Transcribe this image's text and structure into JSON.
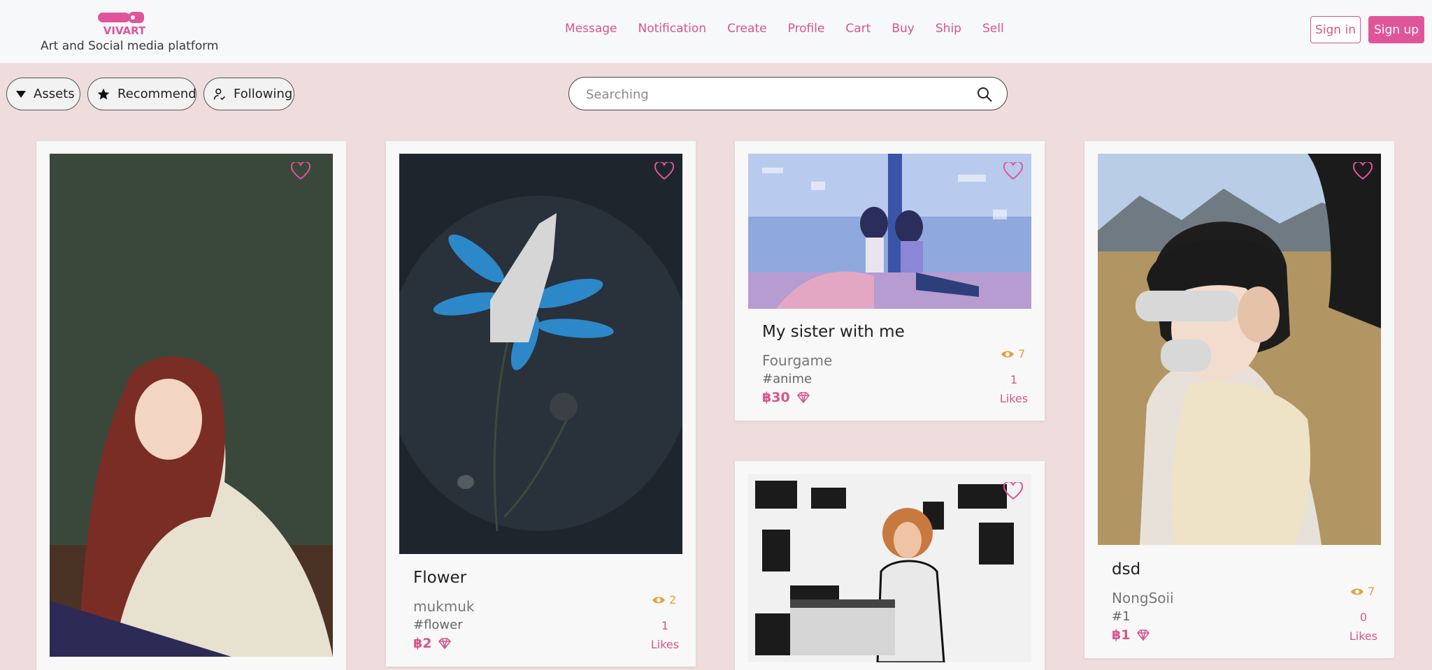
{
  "brand": {
    "logo_text": "VIVART",
    "tagline": "Art and Social media platform",
    "color": "#e0559a"
  },
  "nav": [
    "Message",
    "Notification",
    "Create",
    "Profile",
    "Cart",
    "Buy",
    "Ship",
    "Sell"
  ],
  "auth": {
    "signin": "Sign in",
    "signup": "Sign up"
  },
  "filters": {
    "assets": "Assets",
    "recommend": "Recommend",
    "following": "Following"
  },
  "search": {
    "placeholder": "Searching"
  },
  "cards": [
    {
      "title": "",
      "image": "red-haired girl playing guitar"
    },
    {
      "title": "Flower",
      "author": "mukmuk",
      "tag": "#flower",
      "price": "฿2",
      "views": "2",
      "likes_count": "1",
      "likes_label": "Likes",
      "image": "blue cosmos flower"
    },
    {
      "title": "My sister with me",
      "author": "Fourgame",
      "tag": "#anime",
      "price": "฿30",
      "views": "7",
      "likes_count": "1",
      "likes_label": "Likes",
      "image": "anime girls in bedroom"
    },
    {
      "title": "",
      "image": "man at piano in doodle room"
    },
    {
      "title": "dsd",
      "author": "NongSoii",
      "tag": "#1",
      "price": "฿1",
      "views": "7",
      "likes_count": "0",
      "likes_label": "Likes",
      "image": "person with scarf outdoors"
    }
  ],
  "colors": {
    "accent": "#d6558d",
    "views": "#e2a23a",
    "background": "#efdcdc"
  }
}
